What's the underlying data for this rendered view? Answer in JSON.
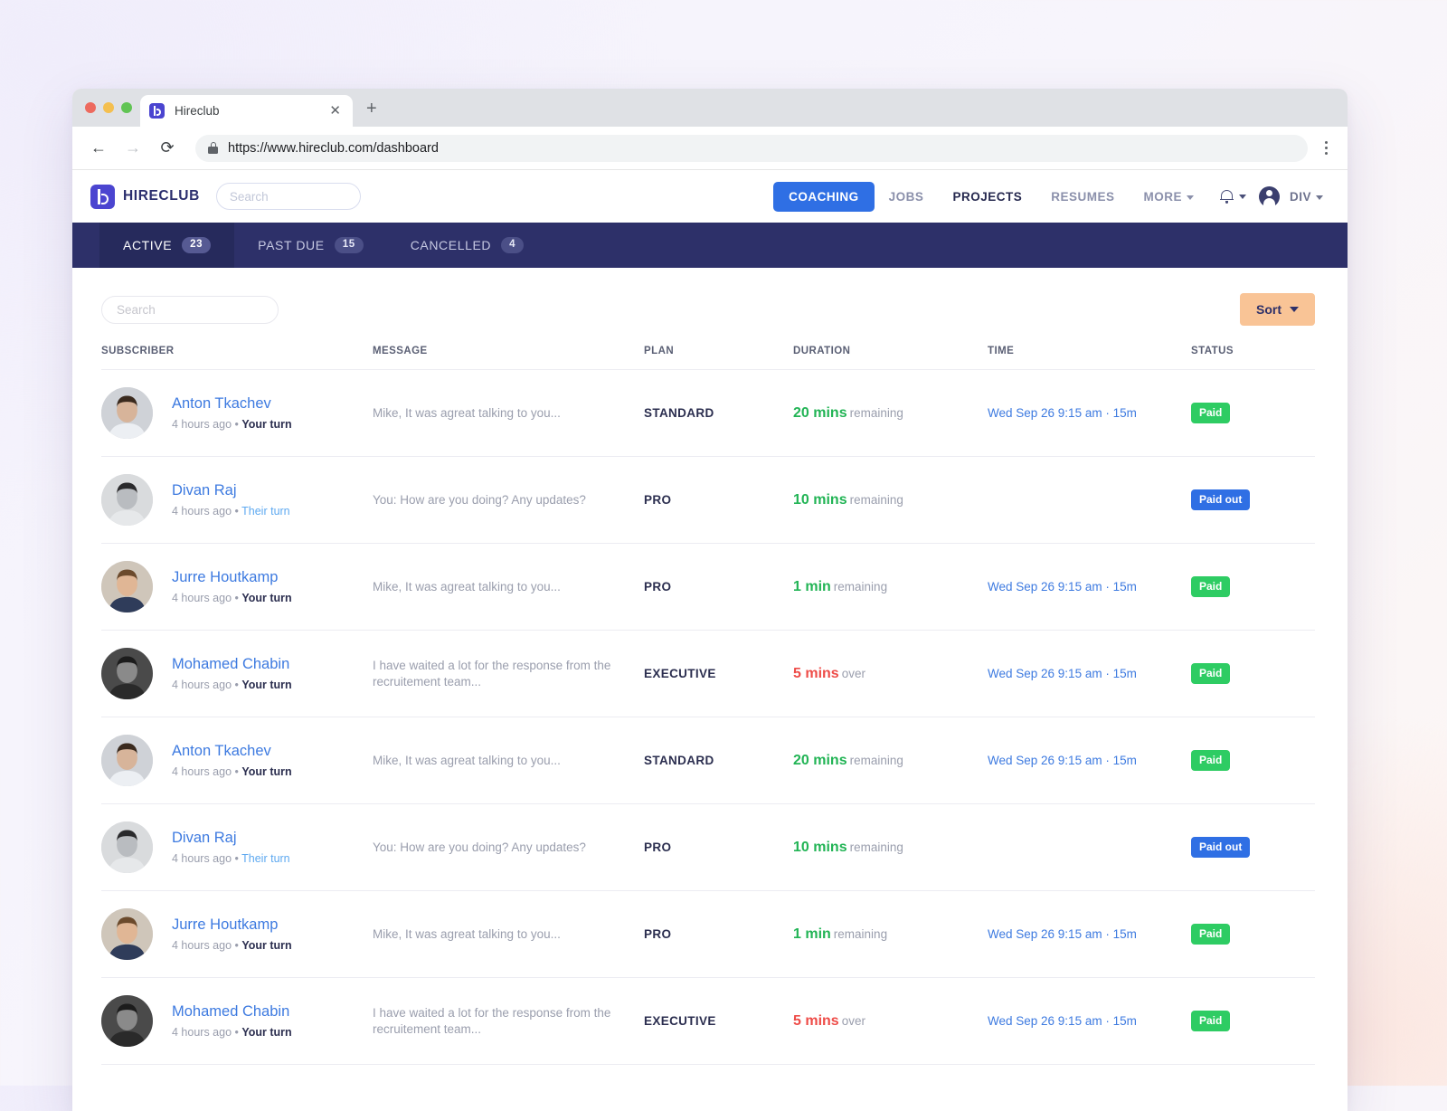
{
  "browser": {
    "tab_title": "Hireclub",
    "tab_favicon_icon": "hireclub-logo-icon",
    "close_icon": "close-icon",
    "new_tab_icon": "plus-icon",
    "back_icon": "back-arrow-icon",
    "forward_icon": "forward-arrow-icon",
    "reload_icon": "reload-icon",
    "lock_icon": "lock-icon",
    "url": "https://www.hireclub.com/dashboard",
    "menu_icon": "kebab-menu-icon"
  },
  "header": {
    "brand": "HIRECLUB",
    "brand_icon": "hireclub-logo-icon",
    "search_placeholder": "Search",
    "search_value": "",
    "nav": [
      {
        "label": "COACHING",
        "state": "active-pill"
      },
      {
        "label": "JOBS",
        "state": "default"
      },
      {
        "label": "PROJECTS",
        "state": "current"
      },
      {
        "label": "RESUMES",
        "state": "default"
      },
      {
        "label": "MORE",
        "state": "dropdown"
      }
    ],
    "bell_icon": "bell-icon",
    "avatar_icon": "user-avatar-icon",
    "user_label": "DIV"
  },
  "tabs": [
    {
      "label": "ACTIVE",
      "count": "23",
      "active": true
    },
    {
      "label": "PAST DUE",
      "count": "15",
      "active": false
    },
    {
      "label": "CANCELLED",
      "count": "4",
      "active": false
    }
  ],
  "toolbar": {
    "search_placeholder": "Search",
    "search_value": "",
    "sort_label": "Sort",
    "sort_caret_icon": "chevron-down-icon"
  },
  "table": {
    "columns": [
      "SUBSCRIBER",
      "MESSAGE",
      "PLAN",
      "DURATION",
      "TIME",
      "STATUS"
    ],
    "rows": [
      {
        "name": "Anton Tkachev",
        "avatar": "avatar-anton",
        "ago": "4 hours ago",
        "turn": "Your turn",
        "turn_style": "you",
        "message": "Mike, It was agreat talking to you...",
        "plan": "STANDARD",
        "duration_value": "20 mins",
        "duration_word": "remaining",
        "duration_state": "ok",
        "time": "Wed Sep 26 9:15 am · 15m",
        "status": "Paid",
        "status_style": "paid"
      },
      {
        "name": "Divan Raj",
        "avatar": "avatar-divan",
        "ago": "4 hours ago",
        "turn": "Their turn",
        "turn_style": "their",
        "message": "You: How are you doing? Any updates?",
        "plan": "PRO",
        "duration_value": "10 mins",
        "duration_word": "remaining",
        "duration_state": "ok",
        "time": "",
        "status": "Paid out",
        "status_style": "paidout"
      },
      {
        "name": "Jurre Houtkamp",
        "avatar": "avatar-jurre",
        "ago": "4 hours ago",
        "turn": "Your turn",
        "turn_style": "you",
        "message": "Mike, It was agreat talking to you...",
        "plan": "PRO",
        "duration_value": "1 min",
        "duration_word": "remaining",
        "duration_state": "ok",
        "time": "Wed Sep 26 9:15 am · 15m",
        "status": "Paid",
        "status_style": "paid"
      },
      {
        "name": "Mohamed Chabin",
        "avatar": "avatar-mohamed",
        "ago": "4 hours ago",
        "turn": "Your turn",
        "turn_style": "you",
        "message": "I have waited a lot for the response from the recruitement team...",
        "plan": "EXECUTIVE",
        "duration_value": "5 mins",
        "duration_word": "over",
        "duration_state": "over",
        "time": "Wed Sep 26 9:15 am · 15m",
        "status": "Paid",
        "status_style": "paid"
      },
      {
        "name": "Anton Tkachev",
        "avatar": "avatar-anton",
        "ago": "4 hours ago",
        "turn": "Your turn",
        "turn_style": "you",
        "message": "Mike, It was agreat talking to you...",
        "plan": "STANDARD",
        "duration_value": "20 mins",
        "duration_word": "remaining",
        "duration_state": "ok",
        "time": "Wed Sep 26 9:15 am · 15m",
        "status": "Paid",
        "status_style": "paid"
      },
      {
        "name": "Divan Raj",
        "avatar": "avatar-divan",
        "ago": "4 hours ago",
        "turn": "Their turn",
        "turn_style": "their",
        "message": "You: How are you doing? Any updates?",
        "plan": "PRO",
        "duration_value": "10 mins",
        "duration_word": "remaining",
        "duration_state": "ok",
        "time": "",
        "status": "Paid out",
        "status_style": "paidout"
      },
      {
        "name": "Jurre Houtkamp",
        "avatar": "avatar-jurre",
        "ago": "4 hours ago",
        "turn": "Your turn",
        "turn_style": "you",
        "message": "Mike, It was agreat talking to you...",
        "plan": "PRO",
        "duration_value": "1 min",
        "duration_word": "remaining",
        "duration_state": "ok",
        "time": "Wed Sep 26 9:15 am · 15m",
        "status": "Paid",
        "status_style": "paid"
      },
      {
        "name": "Mohamed Chabin",
        "avatar": "avatar-mohamed",
        "ago": "4 hours ago",
        "turn": "Your turn",
        "turn_style": "you",
        "message": "I have waited a lot for the response from the recruitement team...",
        "plan": "EXECUTIVE",
        "duration_value": "5 mins",
        "duration_word": "over",
        "duration_state": "over",
        "time": "Wed Sep 26 9:15 am · 15m",
        "status": "Paid",
        "status_style": "paid"
      }
    ]
  },
  "colors": {
    "brand_purple": "#4b45d0",
    "nav_blue": "#2f6fe4",
    "tabs_navy": "#2d3069",
    "sort_peach": "#f9c496",
    "green": "#2ecc63",
    "red": "#ee4c48",
    "link_blue": "#3d7ae0"
  }
}
